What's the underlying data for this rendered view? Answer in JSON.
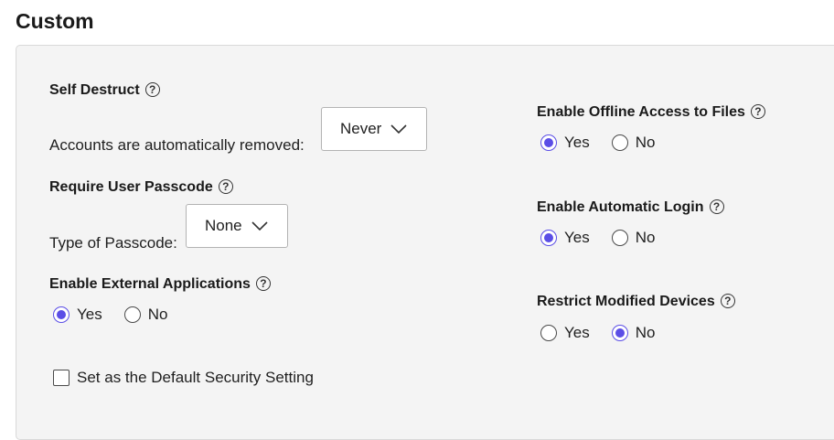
{
  "page_title": "Custom",
  "self_destruct": {
    "label": "Self Destruct",
    "description": "Accounts are automatically removed:",
    "selected": "Never"
  },
  "require_passcode": {
    "label": "Require User Passcode",
    "description": "Type of Passcode:",
    "selected": "None"
  },
  "external_apps": {
    "label": "Enable External Applications",
    "yes": "Yes",
    "no": "No",
    "value": "Yes"
  },
  "offline_access": {
    "label": "Enable Offline Access to Files",
    "yes": "Yes",
    "no": "No",
    "value": "Yes"
  },
  "automatic_login": {
    "label": "Enable Automatic Login",
    "yes": "Yes",
    "no": "No",
    "value": "Yes"
  },
  "modified_devices": {
    "label": "Restrict Modified Devices",
    "yes": "Yes",
    "no": "No",
    "value": "No"
  },
  "default_setting": {
    "label": "Set as the Default Security Setting",
    "checked": false
  },
  "help_glyph": "?",
  "colors": {
    "accent": "#5b4ee6",
    "panel_bg": "#f4f4f4",
    "border": "#d9d9d9"
  }
}
